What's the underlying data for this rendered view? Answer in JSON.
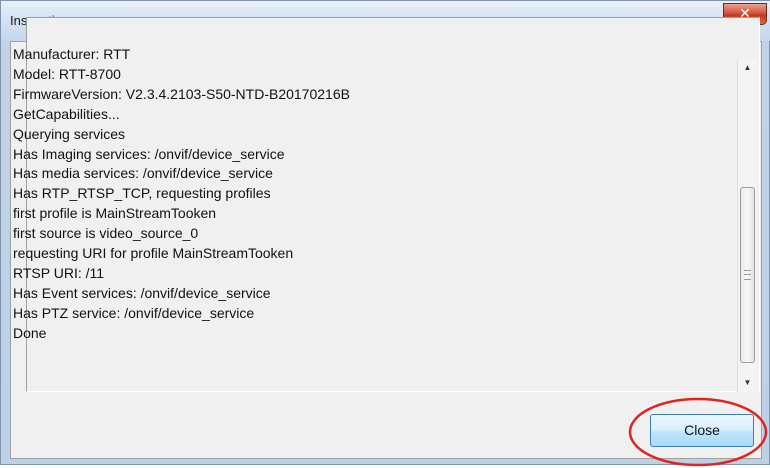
{
  "window": {
    "title": "Inspecting ...",
    "close_x_glyph": "✕"
  },
  "log": {
    "lines": [
      "Manufacturer: RTT",
      "Model: RTT-8700",
      "FirmwareVersion: V2.3.4.2103-S50-NTD-B20170216B",
      "GetCapabilities...",
      "Querying services",
      "Has Imaging services: /onvif/device_service",
      "Has media services: /onvif/device_service",
      "Has RTP_RTSP_TCP, requesting profiles",
      "first profile is MainStreamTooken",
      "first source is video_source_0",
      "requesting URI for profile MainStreamTooken",
      "RTSP URI: /11",
      "Has Event services: /onvif/device_service",
      "Has PTZ service: /onvif/device_service",
      "Done"
    ]
  },
  "scrollbar": {
    "up_glyph": "▲",
    "down_glyph": "▼"
  },
  "buttons": {
    "close_label": "Close"
  },
  "annotation": {
    "ellipse_color": "#e0241f"
  }
}
